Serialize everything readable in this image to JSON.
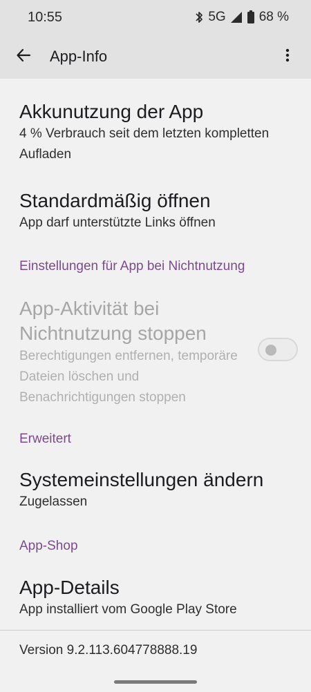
{
  "status_bar": {
    "time": "10:55",
    "network": "5G",
    "battery": "68 %",
    "icons": [
      "bluetooth-icon",
      "signal-icon",
      "battery-icon"
    ]
  },
  "app_bar": {
    "title": "App-Info",
    "back_icon": "arrow-back-icon",
    "more_icon": "more-vert-icon"
  },
  "items": {
    "battery": {
      "title": "Akkunutzung der App",
      "subtitle": "4 % Verbrauch seit dem letzten kompletten Aufladen"
    },
    "open_default": {
      "title": "Standardmäßig öffnen",
      "subtitle": "App darf unterstützte Links öffnen"
    },
    "pause_activity": {
      "title": "App-Aktivität bei Nichtnutzung stoppen",
      "subtitle": "Berechtigungen entfernen, temporäre Dateien löschen und Benachrichtigungen stoppen",
      "toggle_on": false,
      "enabled": false
    },
    "system_settings": {
      "title": "Systemeinstellungen ändern",
      "subtitle": "Zugelassen"
    },
    "app_details": {
      "title": "App-Details",
      "subtitle": "App installiert vom Google Play Store"
    }
  },
  "sections": {
    "unused": "Einstellungen für App bei Nichtnutzung",
    "advanced": "Erweitert",
    "store": "App-Shop"
  },
  "footer": {
    "version": "Version 9.2.113.604778888.19"
  },
  "colors": {
    "accent": "#7b4a8f",
    "bar_background": "#e2e2e2",
    "page_background": "#f1f1f1"
  }
}
